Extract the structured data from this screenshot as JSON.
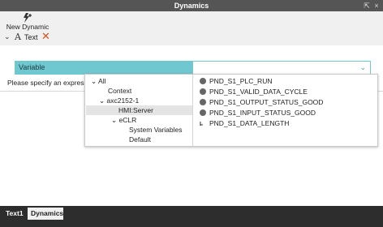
{
  "window": {
    "title": "Dynamics",
    "restore_glyph": "⇱",
    "close_glyph": "×"
  },
  "toolbar": {
    "new_dynamic_label": "New Dynamic",
    "new_dynamic_icon": "lightning-plus-icon"
  },
  "section": {
    "chevron": "⌄",
    "icon_glyph": "A",
    "label": "Text",
    "delete_glyph": "✕"
  },
  "variable": {
    "label": "Variable",
    "value": "",
    "dropdown_glyph": "⌄",
    "hint": "Please specify an expression"
  },
  "tree": {
    "items": [
      {
        "label": "All",
        "chevron": "⌄"
      },
      {
        "label": "Context",
        "chevron": ""
      },
      {
        "label": "axc2152-1",
        "chevron": "⌄"
      },
      {
        "label": "HMI:Server",
        "chevron": ""
      },
      {
        "label": "eCLR",
        "chevron": "⌄"
      },
      {
        "label": "System Variables",
        "chevron": ""
      },
      {
        "label": "Default",
        "chevron": ""
      }
    ]
  },
  "variables": {
    "items": [
      {
        "label": "PND_S1_PLC_RUN",
        "icon": "bool-icon"
      },
      {
        "label": "PND_S1_VALID_DATA_CYCLE",
        "icon": "bool-icon"
      },
      {
        "label": "PND_S1_OUTPUT_STATUS_GOOD",
        "icon": "bool-icon"
      },
      {
        "label": "PND_S1_INPUT_STATUS_GOOD",
        "icon": "bool-icon"
      },
      {
        "label": "PND_S1_DATA_LENGTH",
        "icon": "int-icon",
        "icon_glyph": "I₀"
      }
    ]
  },
  "tabs": [
    {
      "label": "Text1"
    },
    {
      "label": "Dynamics"
    }
  ],
  "colors": {
    "accent": "#6fc7cf",
    "titlebar": "#555555",
    "delete": "#e0501f"
  }
}
